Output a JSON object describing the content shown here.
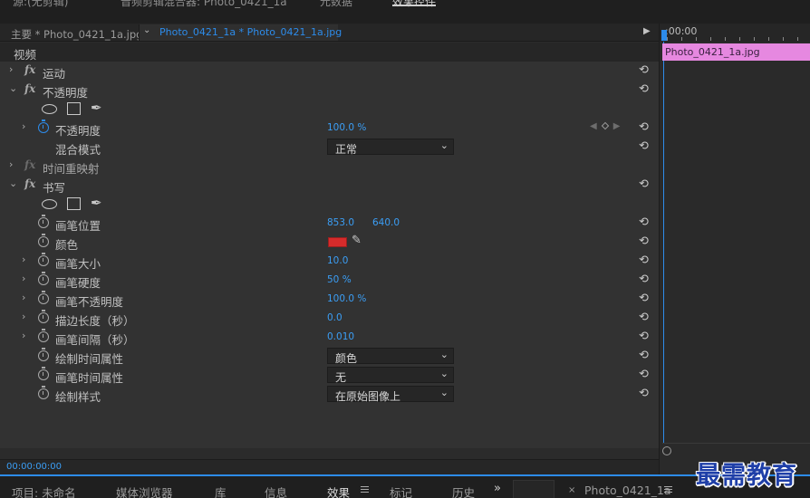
{
  "top_tabs": [
    {
      "label": "源:(无剪辑)",
      "active": false
    },
    {
      "label": "音频剪辑混合器: Photo_0421_1a",
      "active": false
    },
    {
      "label": "元数据",
      "active": false
    },
    {
      "label": "效果控件",
      "active": true
    }
  ],
  "header": {
    "clip_label": "主要 * Photo_0421_1a.jpg",
    "sequence_label": "Photo_0421_1a * Photo_0421_1a.jpg"
  },
  "rows": {
    "video_section": "视频",
    "motion": "运动",
    "opacity_effect": "不透明度",
    "opacity_prop": "不透明度",
    "opacity_value": "100.0 %",
    "blend_mode": "混合模式",
    "blend_mode_value": "正常",
    "time_remap": "时间重映射",
    "write_effect": "书写",
    "brush_position": "画笔位置",
    "brush_position_x": "853.0",
    "brush_position_y": "640.0",
    "color": "颜色",
    "color_value": "#d62b2b",
    "brush_size": "画笔大小",
    "brush_size_value": "10.0",
    "brush_hardness": "画笔硬度",
    "brush_hardness_value": "50 %",
    "brush_opacity": "画笔不透明度",
    "brush_opacity_value": "100.0 %",
    "stroke_length": "描边长度（秒）",
    "stroke_length_value": "0.0",
    "brush_spacing": "画笔间隔（秒）",
    "brush_spacing_value": "0.010",
    "paint_time_props": "绘制时间属性",
    "paint_time_props_value": "颜色",
    "brush_time_props": "画笔时间属性",
    "brush_time_props_value": "无",
    "paint_style": "绘制样式",
    "paint_style_value": "在原始图像上"
  },
  "footer": {
    "timecode": "00:00:00:00"
  },
  "timeline": {
    "ruler_start": ":00:00",
    "clip_name": "Photo_0421_1a.jpg",
    "clip_color": "#e688e0"
  },
  "bottom_tabs": {
    "project": "项目: 未命名",
    "media_browser": "媒体浏览器",
    "library": "库",
    "info": "信息",
    "effects": "效果",
    "markers": "标记",
    "history": "历史",
    "more": "»",
    "sequence": "Photo_0421_1a"
  },
  "watermark": "最需教育",
  "accent_color": "#2d8ceb"
}
